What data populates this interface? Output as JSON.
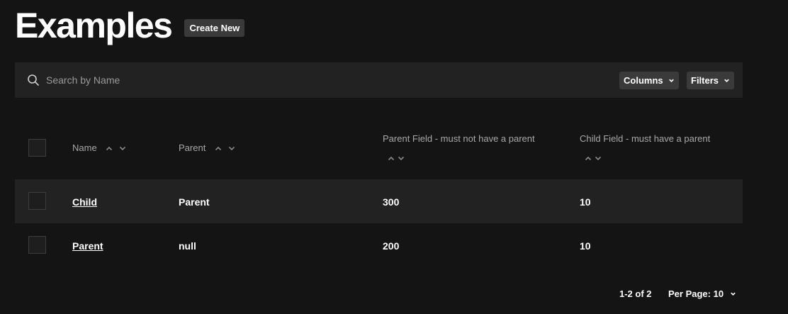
{
  "header": {
    "title": "Examples",
    "create_label": "Create New"
  },
  "toolbar": {
    "search_placeholder": "Search by Name",
    "columns_label": "Columns",
    "filters_label": "Filters"
  },
  "table": {
    "columns": [
      "Name",
      "Parent",
      "Parent Field - must not have a parent",
      "Child Field - must have a parent"
    ],
    "rows": [
      {
        "name": "Child",
        "parent": "Parent",
        "parent_field": "300",
        "child_field": "10"
      },
      {
        "name": "Parent",
        "parent": "null",
        "parent_field": "200",
        "child_field": "10"
      }
    ]
  },
  "footer": {
    "range": "1-2 of 2",
    "per_page": "Per Page: 10"
  },
  "colors": {
    "background": "#141414",
    "panel": "#222222",
    "button": "#3a3a3a",
    "muted_text": "#a8a8a8"
  }
}
